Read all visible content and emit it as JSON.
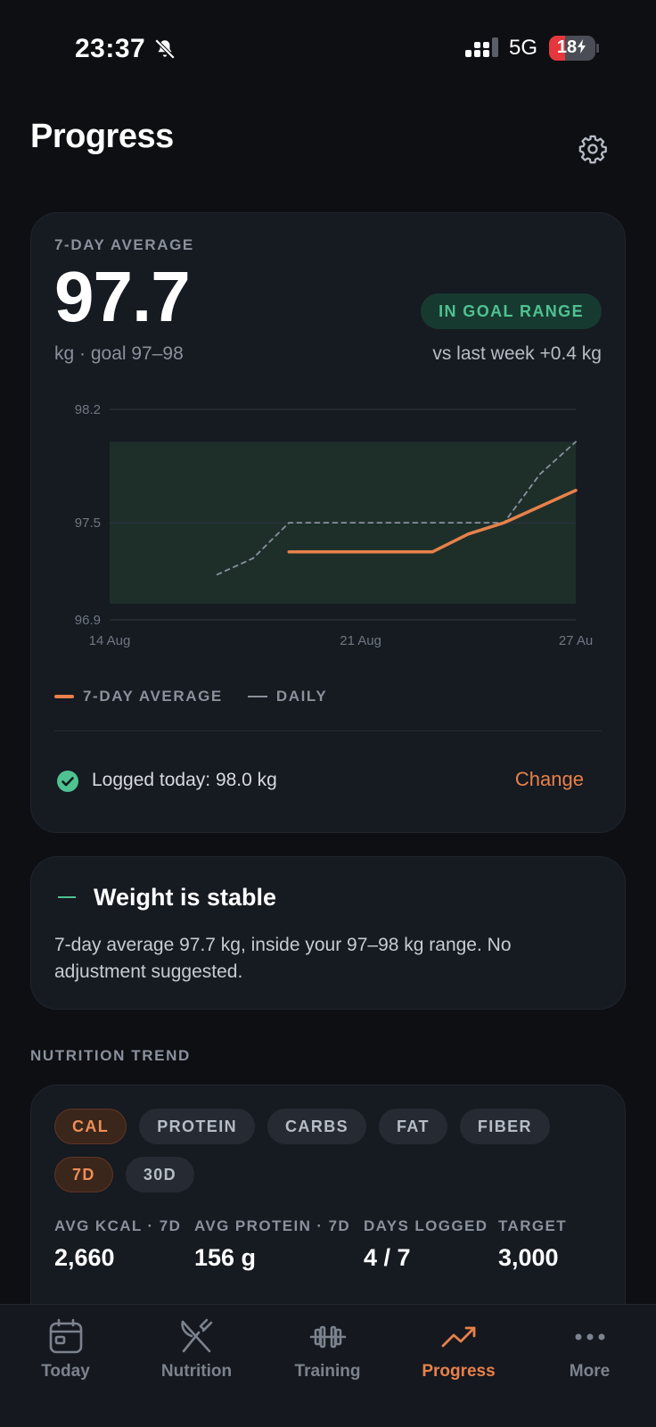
{
  "status_bar": {
    "time": "23:37",
    "network": "5G",
    "battery": "18",
    "battery_level": 0.18,
    "icons": [
      "bell-off-icon",
      "cellular-signal-icon",
      "battery-charging-icon"
    ]
  },
  "header": {
    "title": "Progress",
    "settings_icon": "gear-icon"
  },
  "weight_card": {
    "eyebrow": "7-DAY AVERAGE",
    "value": "97.7",
    "unit_goal": "kg · goal 97–98",
    "badge": "IN GOAL RANGE",
    "vs_last_week": "vs last week +0.4 kg",
    "legend": {
      "avg": "7-DAY AVERAGE",
      "daily": "DAILY"
    },
    "logged_today": "Logged today: 98.0 kg",
    "change_label": "Change"
  },
  "chart_data": {
    "type": "line",
    "title": "",
    "xlabel": "",
    "ylabel": "",
    "x_range": [
      "2023-08-14",
      "2023-08-27"
    ],
    "ylim": [
      96.9,
      98.2
    ],
    "y_ticks": [
      98.2,
      97.5,
      96.9
    ],
    "x_ticks": [
      "14 Aug",
      "21 Aug",
      "27 Au"
    ],
    "goal_band": [
      97.0,
      98.0
    ],
    "grid": true,
    "series": [
      {
        "name": "7-DAY AVERAGE",
        "color": "#e8814a",
        "style": "solid",
        "points": [
          {
            "x": "2023-08-19",
            "y": 97.32
          },
          {
            "x": "2023-08-23",
            "y": 97.32
          },
          {
            "x": "2023-08-24",
            "y": 97.43
          },
          {
            "x": "2023-08-25",
            "y": 97.5
          },
          {
            "x": "2023-08-27",
            "y": 97.7
          }
        ]
      },
      {
        "name": "DAILY",
        "color": "#8a919c",
        "style": "dashed",
        "points": [
          {
            "x": "2023-08-17",
            "y": 97.18
          },
          {
            "x": "2023-08-18",
            "y": 97.28
          },
          {
            "x": "2023-08-19",
            "y": 97.5
          },
          {
            "x": "2023-08-25",
            "y": 97.5
          },
          {
            "x": "2023-08-26",
            "y": 97.8
          },
          {
            "x": "2023-08-27",
            "y": 98.0
          }
        ]
      }
    ]
  },
  "status_card": {
    "title": "Weight is stable",
    "body": "7-day average 97.7 kg, inside your 97–98 kg range. No adjustment suggested."
  },
  "nutrition": {
    "section_label": "NUTRITION TREND",
    "metric_chips": [
      {
        "label": "CAL",
        "active": true
      },
      {
        "label": "PROTEIN",
        "active": false
      },
      {
        "label": "CARBS",
        "active": false
      },
      {
        "label": "FAT",
        "active": false
      },
      {
        "label": "FIBER",
        "active": false
      }
    ],
    "range_chips": [
      {
        "label": "7D",
        "active": true
      },
      {
        "label": "30D",
        "active": false
      }
    ],
    "stats": [
      {
        "label": "AVG KCAL · 7D",
        "value": "2,660"
      },
      {
        "label": "AVG PROTEIN · 7D",
        "value": "156 g"
      },
      {
        "label": "DAYS LOGGED",
        "value": "4 / 7"
      },
      {
        "label": "TARGET",
        "value": "3,000"
      }
    ]
  },
  "bottom_nav": [
    {
      "label": "Today",
      "icon": "calendar-icon",
      "active": false
    },
    {
      "label": "Nutrition",
      "icon": "fork-knife-icon",
      "active": false
    },
    {
      "label": "Training",
      "icon": "dumbbell-icon",
      "active": false
    },
    {
      "label": "Progress",
      "icon": "trend-up-icon",
      "active": true
    },
    {
      "label": "More",
      "icon": "more-dots-icon",
      "active": false
    }
  ],
  "colors": {
    "accent": "#e8814a",
    "good": "#4fc292",
    "card": "#161a21",
    "background": "#0d0f13"
  }
}
